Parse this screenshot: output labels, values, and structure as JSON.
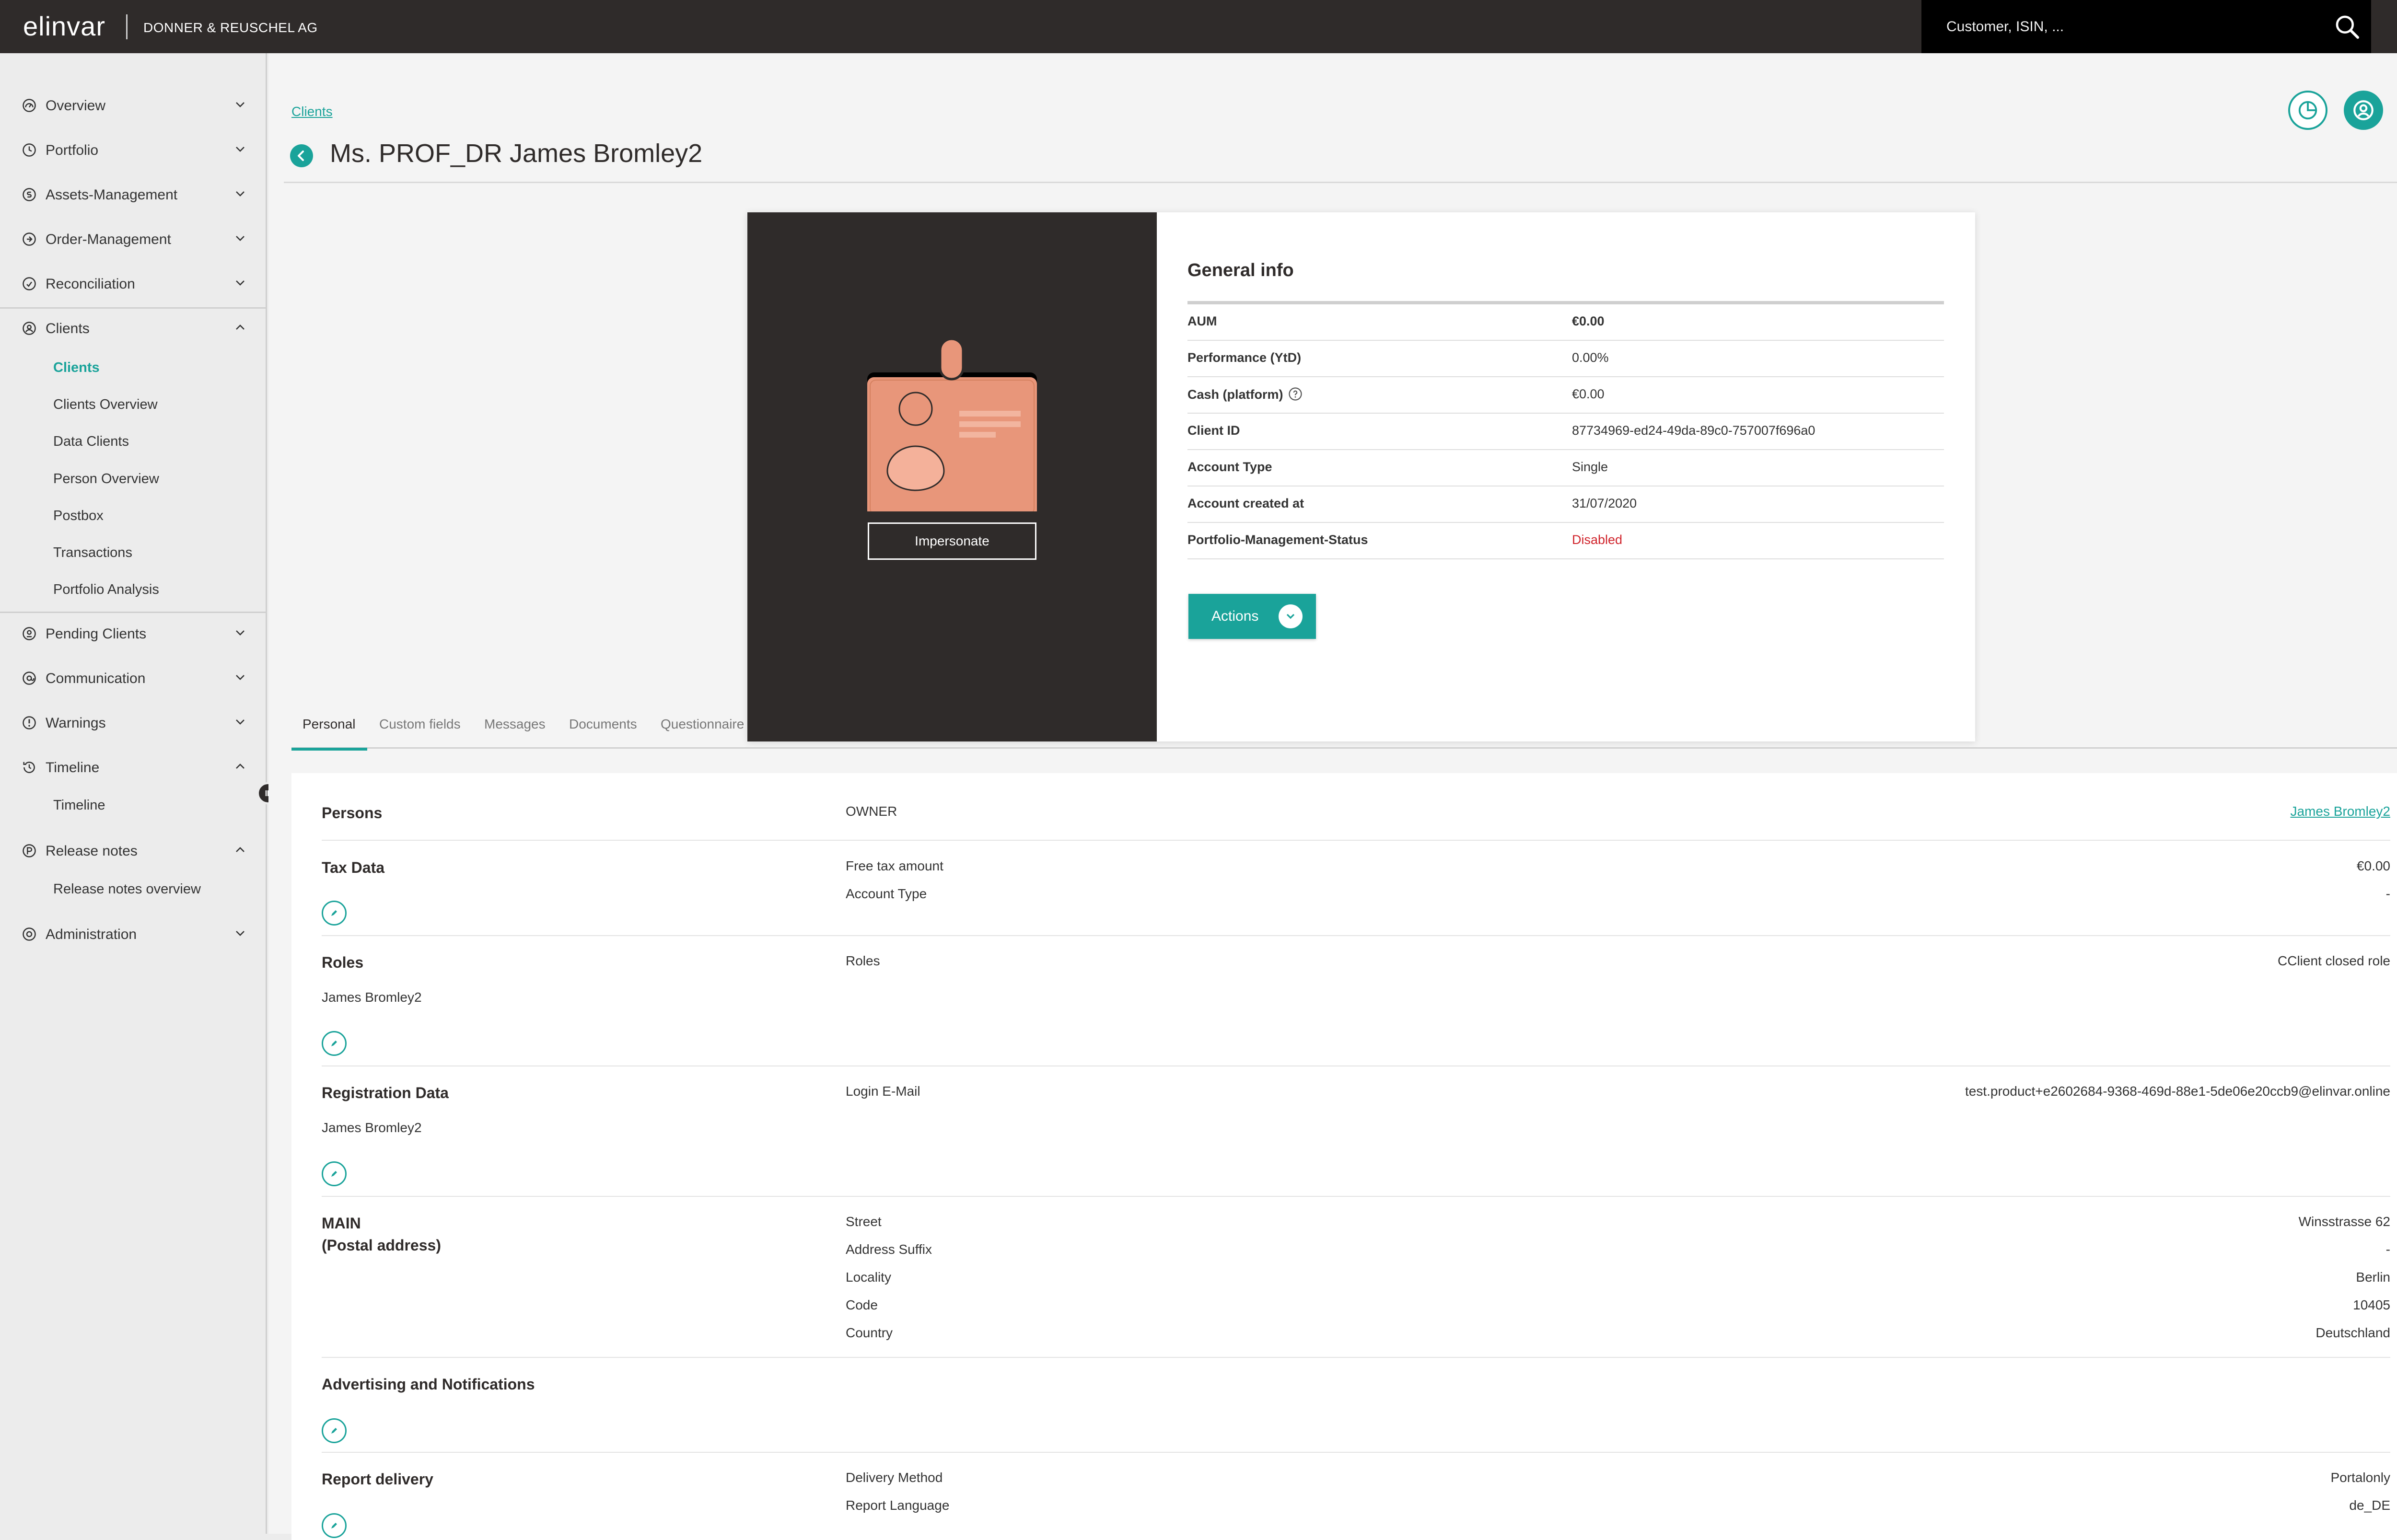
{
  "header": {
    "logo": "elinvar",
    "company": "DONNER & REUSCHEL AG",
    "search_placeholder": "Customer, ISIN, ..."
  },
  "sidebar": {
    "items": [
      {
        "label": "Overview",
        "icon": "gauge-icon",
        "expanded": false
      },
      {
        "label": "Portfolio",
        "icon": "clock-icon",
        "expanded": false
      },
      {
        "label": "Assets-Management",
        "icon": "assets-icon",
        "expanded": false
      },
      {
        "label": "Order-Management",
        "icon": "order-icon",
        "expanded": false
      },
      {
        "label": "Reconciliation",
        "icon": "reconcile-icon",
        "expanded": false
      },
      {
        "label": "Clients",
        "icon": "user-circle-icon",
        "expanded": true
      },
      {
        "label": "Pending Clients",
        "icon": "pending-icon",
        "expanded": false
      },
      {
        "label": "Communication",
        "icon": "at-icon",
        "expanded": false
      },
      {
        "label": "Warnings",
        "icon": "warning-icon",
        "expanded": false
      },
      {
        "label": "Timeline",
        "icon": "history-icon",
        "expanded": true
      },
      {
        "label": "Release notes",
        "icon": "release-icon",
        "expanded": true
      },
      {
        "label": "Administration",
        "icon": "gear-icon",
        "expanded": false
      }
    ],
    "clients_sub": [
      "Clients",
      "Clients Overview",
      "Data Clients",
      "Person Overview",
      "Postbox",
      "Transactions",
      "Portfolio Analysis"
    ],
    "timeline_sub": [
      "Timeline"
    ],
    "release_sub": [
      "Release notes overview"
    ]
  },
  "breadcrumb": "Clients",
  "page_title": "Ms. PROF_DR James Bromley2",
  "card": {
    "impersonate_label": "Impersonate",
    "general_info_title": "General info",
    "rows": [
      {
        "key": "AUM",
        "value": "€0.00"
      },
      {
        "key": "Performance (YtD)",
        "value": "0.00%"
      },
      {
        "key": "Cash (platform)",
        "value": "€0.00"
      },
      {
        "key": "Client ID",
        "value": "87734969-ed24-49da-89c0-757007f696a0"
      },
      {
        "key": "Account Type",
        "value": "Single"
      },
      {
        "key": "Account created at",
        "value": "31/07/2020"
      },
      {
        "key": "Portfolio-Management-Status",
        "value": "Disabled"
      }
    ],
    "actions_label": "Actions"
  },
  "tabs": [
    "Personal",
    "Custom fields",
    "Messages",
    "Documents",
    "Questionnaire"
  ],
  "sections": {
    "persons": {
      "title": "Persons",
      "field_key": "OWNER",
      "field_value": "James Bromley2"
    },
    "tax": {
      "title": "Tax Data",
      "fields": [
        {
          "key": "Free tax amount",
          "value": "€0.00"
        },
        {
          "key": "Account Type",
          "value": "-"
        }
      ]
    },
    "roles": {
      "title": "Roles",
      "subtitle": "James Bromley2",
      "field_key": "Roles",
      "field_value": "CClient closed role"
    },
    "registration": {
      "title": "Registration Data",
      "subtitle": "James Bromley2",
      "field_key": "Login E-Mail",
      "field_value": "test.product+e2602684-9368-469d-88e1-5de06e20ccb9@elinvar.online"
    },
    "address": {
      "title_line1": "MAIN",
      "title_line2": "(Postal address)",
      "fields": [
        {
          "key": "Street",
          "value": "Winsstrasse 62"
        },
        {
          "key": "Address Suffix",
          "value": "-"
        },
        {
          "key": "Locality",
          "value": "Berlin"
        },
        {
          "key": "Code",
          "value": "10405"
        },
        {
          "key": "Country",
          "value": "Deutschland"
        }
      ]
    },
    "advertising": {
      "title": "Advertising and Notifications"
    },
    "report": {
      "title": "Report delivery",
      "fields": [
        {
          "key": "Delivery Method",
          "value": "Portalonly"
        },
        {
          "key": "Report Language",
          "value": "de_DE"
        }
      ]
    }
  },
  "colors": {
    "accent": "#1aa39a",
    "dark": "#2f2b2a",
    "danger": "#d0232b",
    "badge": "#e8967a"
  }
}
